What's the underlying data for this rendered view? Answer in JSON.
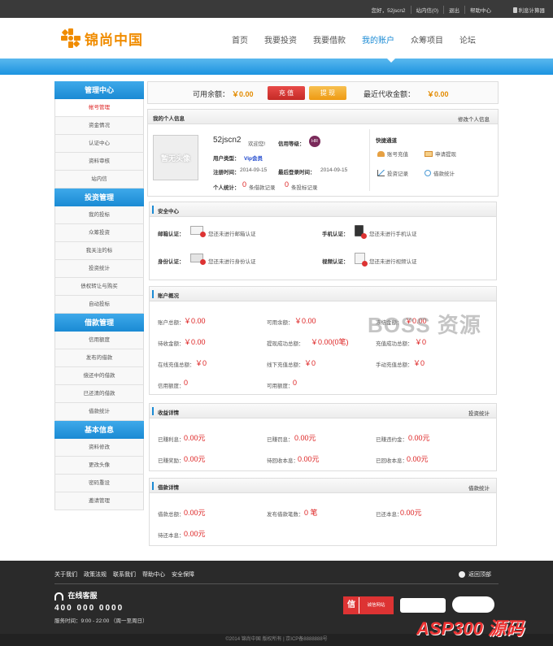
{
  "topbar": {
    "greeting": "您好，52jscn2",
    "inbox": "站内信(0)",
    "logout": "退出",
    "help": "帮助中心",
    "calculator": "利息计算器"
  },
  "logo": {
    "text": "锦尚中国"
  },
  "nav": [
    "首页",
    "我要投资",
    "我要借款",
    "我的账户",
    "众筹项目",
    "论坛"
  ],
  "sidebar": {
    "sections": [
      {
        "title": "管理中心",
        "items": [
          "帐号管理",
          "资金情况",
          "认证中心",
          "资料审核",
          "站内信"
        ]
      },
      {
        "title": "投资管理",
        "items": [
          "我的投标",
          "众筹投资",
          "我关注的标",
          "投资统计",
          "债权转让与购买",
          "自动投标"
        ]
      },
      {
        "title": "借款管理",
        "items": [
          "信用额度",
          "发布的借款",
          "偿还中的借款",
          "已还清的借款",
          "借款统计"
        ]
      },
      {
        "title": "基本信息",
        "items": [
          "资料修改",
          "更改头像",
          "密码重设",
          "邀请管理"
        ]
      }
    ]
  },
  "balance": {
    "available_label": "可用余额：",
    "available_value": "￥0.00",
    "recharge": "充 值",
    "withdraw": "提 现",
    "recent_label": "最近代收金额：",
    "recent_value": "￥0.00"
  },
  "profile": {
    "title": "我的个人信息",
    "edit": "修改个人信息",
    "avatar": "暂无头像",
    "username": "52jscn2",
    "welcome": "欢迎您!",
    "credit_label": "信用等级：",
    "credit_badge": "HR",
    "user_type_label": "用户类型：",
    "user_type": "Vip会员",
    "reg_label": "注册时间：",
    "reg_time": "2014-09-15",
    "last_label": "最后登录时间：",
    "last_time": "2014-09-15",
    "stats_label": "个人统计：",
    "borrow_count": "0",
    "borrow_text": "条借款记录",
    "invest_count": "0",
    "invest_text": "条投标记录",
    "quick_title": "快捷通道",
    "quick": [
      "账号充值",
      "申请提现",
      "投资记录",
      "借款统计"
    ]
  },
  "security": {
    "title": "安全中心",
    "items": [
      {
        "label": "邮箱认证：",
        "text": "您还未进行邮箱认证"
      },
      {
        "label": "手机认证：",
        "text": "您还未进行手机认证"
      },
      {
        "label": "身份认证：",
        "text": "您还未进行身份认证"
      },
      {
        "label": "视频认证：",
        "text": "您还未进行视频认证"
      }
    ]
  },
  "account": {
    "title": "账户概况",
    "rows": [
      [
        {
          "label": "账户总额：",
          "value": "￥0.00"
        },
        {
          "label": "可用余额：",
          "value": "￥0.00"
        },
        {
          "label": "冻结金额：",
          "value": "￥0.00"
        }
      ],
      [
        {
          "label": "待收金额：",
          "value": "￥0.00"
        },
        {
          "label": "提现成功总额：",
          "value": "￥0.00(0笔)"
        },
        {
          "label": "充值成功总额：",
          "value": "￥0"
        }
      ],
      [
        {
          "label": "在线充值总额：",
          "value": "￥0"
        },
        {
          "label": "线下充值总额：",
          "value": "￥0"
        },
        {
          "label": "手动充值总额：",
          "value": "￥0"
        }
      ],
      [
        {
          "label": "信用额度：",
          "value": "0"
        },
        {
          "label": "可用额度：",
          "value": "0"
        }
      ]
    ]
  },
  "income": {
    "title": "收益详情",
    "link": "投资统计",
    "rows": [
      [
        {
          "label": "已赚利息：",
          "value": "0.00元"
        },
        {
          "label": "已赚罚息：",
          "value": "0.00元"
        },
        {
          "label": "已赚违约金：",
          "value": "0.00元"
        }
      ],
      [
        {
          "label": "已赚奖励：",
          "value": "0.00元"
        },
        {
          "label": "待回收本息：",
          "value": "0.00元"
        },
        {
          "label": "已回收本息：",
          "value": "0.00元"
        }
      ]
    ]
  },
  "loan": {
    "title": "借款详情",
    "link": "借款统计",
    "rows": [
      [
        {
          "label": "借款总额：",
          "value": "0.00元"
        },
        {
          "label": "发布借款笔数：",
          "value": "0 笔"
        },
        {
          "label": "已还本息：",
          "value": "0.00元"
        }
      ],
      [
        {
          "label": "待还本息：",
          "value": "0.00元"
        }
      ]
    ]
  },
  "footer": {
    "links": [
      "关于我们",
      "政策法规",
      "联系我们",
      "帮助中心",
      "安全保障"
    ],
    "totop": "返回顶部",
    "service": "在线客服",
    "phone": "400 000 0000",
    "hours": "服务时间：9:00 - 22:00 （周一至周日）",
    "badge": "诚信网站",
    "copyright": "©2014 锦尚中国 版权所有 | 京ICP备8888888号"
  },
  "watermarks": [
    "BOSS 资源",
    "ASP300 源码"
  ],
  "colors": {
    "accent": "#1a8ad4",
    "orange": "#f08c00",
    "red": "#d22222"
  }
}
